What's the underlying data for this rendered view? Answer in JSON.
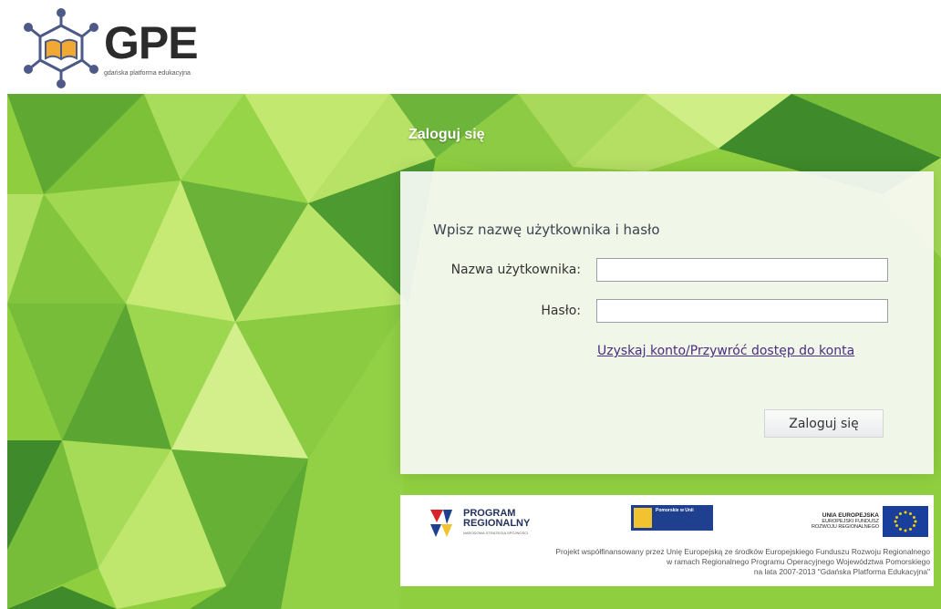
{
  "logo": {
    "name": "GPE",
    "subtitle": "gdańska platforma edukacyjna"
  },
  "login": {
    "title": "Zaloguj się",
    "heading": "Wpisz nazwę użytkownika i hasło",
    "username_label": "Nazwa użytkownika:",
    "username_value": "",
    "password_label": "Hasło:",
    "password_value": "",
    "recover_link": "Uzyskaj konto/Przywróć dostęp do konta",
    "submit_label": "Zaloguj się"
  },
  "footer": {
    "program_line1": "PROGRAM",
    "program_line2": "REGIONALNY",
    "program_sub": "NARODOWA STRATEGIA SPÓJNOŚCI",
    "pomorskie_text": "Pomorskie w Unii",
    "eu_line1": "UNIA EUROPEJSKA",
    "eu_line2": "EUROPEJSKI FUNDUSZ",
    "eu_line3": "ROZWOJU REGIONALNEGO",
    "note_line1": "Projekt współfinansowany przez Unię Europejską ze środków Europejskiego Funduszu Rozwoju Regionalnego",
    "note_line2": "w ramach Regionalnego Programu Operacyjnego Województwa Pomorskiego",
    "note_line3": "na lata 2007-2013 \"Gdańska Platforma Edukacyjna\""
  },
  "colors": {
    "accent_green": "#8cc63f",
    "link": "#4b2d83",
    "text": "#3b4450"
  },
  "icons": {
    "logo": "open-book-molecule-icon",
    "program_regionalny": "program-regionalny-logo",
    "pomorskie": "pomorskie-logo",
    "eu": "eu-flag-icon"
  }
}
